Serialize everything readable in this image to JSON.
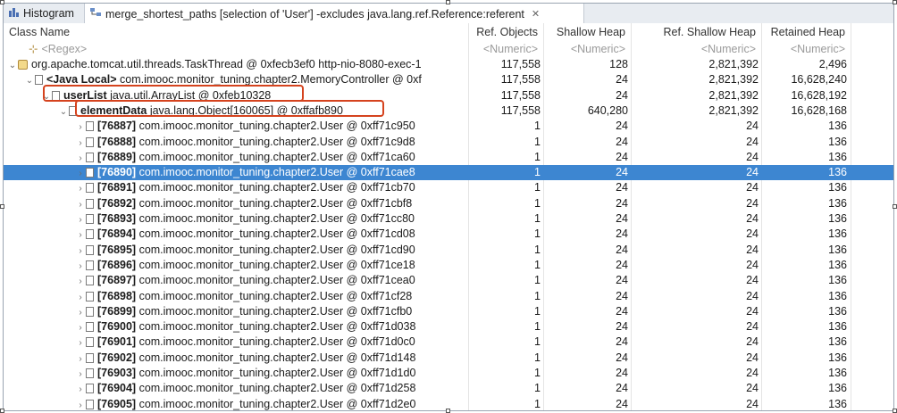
{
  "tabs": [
    {
      "label": "Histogram"
    },
    {
      "label": "merge_shortest_paths [selection of 'User'] -excludes java.lang.ref.Reference:referent"
    }
  ],
  "columns": [
    "Class Name",
    "Ref. Objects",
    "Shallow Heap",
    "Ref. Shallow Heap",
    "Retained Heap"
  ],
  "filters": [
    "<Regex>",
    "<Numeric>",
    "<Numeric>",
    "<Numeric>",
    "<Numeric>"
  ],
  "rows": [
    {
      "name": "org.apache.tomcat.util.threads.TaskThread @ 0xfecb3ef0  http-nio-8080-exec-1",
      "ref": "117,558",
      "shallow": "128",
      "ref_shallow": "2,821,392",
      "retained": "2,496"
    },
    {
      "name_bold": "<Java Local>",
      "name": "com.imooc.monitor_tuning.chapter2.MemoryController @ 0xf",
      "ref": "117,558",
      "shallow": "24",
      "ref_shallow": "2,821,392",
      "retained": "16,628,240"
    },
    {
      "name_bold": "userList",
      "name": "java.util.ArrayList @ 0xfeb10328",
      "ref": "117,558",
      "shallow": "24",
      "ref_shallow": "2,821,392",
      "retained": "16,628,192"
    },
    {
      "name_bold": "elementData",
      "name": "java.lang.Object[160065] @ 0xffafb890",
      "ref": "117,558",
      "shallow": "640,280",
      "ref_shallow": "2,821,392",
      "retained": "16,628,168"
    },
    {
      "name_bold": "[76887]",
      "name": "com.imooc.monitor_tuning.chapter2.User @ 0xff71c950",
      "ref": "1",
      "shallow": "24",
      "ref_shallow": "24",
      "retained": "136"
    },
    {
      "name_bold": "[76888]",
      "name": "com.imooc.monitor_tuning.chapter2.User @ 0xff71c9d8",
      "ref": "1",
      "shallow": "24",
      "ref_shallow": "24",
      "retained": "136"
    },
    {
      "name_bold": "[76889]",
      "name": "com.imooc.monitor_tuning.chapter2.User @ 0xff71ca60",
      "ref": "1",
      "shallow": "24",
      "ref_shallow": "24",
      "retained": "136"
    },
    {
      "name_bold": "[76890]",
      "name": "com.imooc.monitor_tuning.chapter2.User @ 0xff71cae8",
      "ref": "1",
      "shallow": "24",
      "ref_shallow": "24",
      "retained": "136",
      "selected": true
    },
    {
      "name_bold": "[76891]",
      "name": "com.imooc.monitor_tuning.chapter2.User @ 0xff71cb70",
      "ref": "1",
      "shallow": "24",
      "ref_shallow": "24",
      "retained": "136"
    },
    {
      "name_bold": "[76892]",
      "name": "com.imooc.monitor_tuning.chapter2.User @ 0xff71cbf8",
      "ref": "1",
      "shallow": "24",
      "ref_shallow": "24",
      "retained": "136"
    },
    {
      "name_bold": "[76893]",
      "name": "com.imooc.monitor_tuning.chapter2.User @ 0xff71cc80",
      "ref": "1",
      "shallow": "24",
      "ref_shallow": "24",
      "retained": "136"
    },
    {
      "name_bold": "[76894]",
      "name": "com.imooc.monitor_tuning.chapter2.User @ 0xff71cd08",
      "ref": "1",
      "shallow": "24",
      "ref_shallow": "24",
      "retained": "136"
    },
    {
      "name_bold": "[76895]",
      "name": "com.imooc.monitor_tuning.chapter2.User @ 0xff71cd90",
      "ref": "1",
      "shallow": "24",
      "ref_shallow": "24",
      "retained": "136"
    },
    {
      "name_bold": "[76896]",
      "name": "com.imooc.monitor_tuning.chapter2.User @ 0xff71ce18",
      "ref": "1",
      "shallow": "24",
      "ref_shallow": "24",
      "retained": "136"
    },
    {
      "name_bold": "[76897]",
      "name": "com.imooc.monitor_tuning.chapter2.User @ 0xff71cea0",
      "ref": "1",
      "shallow": "24",
      "ref_shallow": "24",
      "retained": "136"
    },
    {
      "name_bold": "[76898]",
      "name": "com.imooc.monitor_tuning.chapter2.User @ 0xff71cf28",
      "ref": "1",
      "shallow": "24",
      "ref_shallow": "24",
      "retained": "136"
    },
    {
      "name_bold": "[76899]",
      "name": "com.imooc.monitor_tuning.chapter2.User @ 0xff71cfb0",
      "ref": "1",
      "shallow": "24",
      "ref_shallow": "24",
      "retained": "136"
    },
    {
      "name_bold": "[76900]",
      "name": "com.imooc.monitor_tuning.chapter2.User @ 0xff71d038",
      "ref": "1",
      "shallow": "24",
      "ref_shallow": "24",
      "retained": "136"
    },
    {
      "name_bold": "[76901]",
      "name": "com.imooc.monitor_tuning.chapter2.User @ 0xff71d0c0",
      "ref": "1",
      "shallow": "24",
      "ref_shallow": "24",
      "retained": "136"
    },
    {
      "name_bold": "[76902]",
      "name": "com.imooc.monitor_tuning.chapter2.User @ 0xff71d148",
      "ref": "1",
      "shallow": "24",
      "ref_shallow": "24",
      "retained": "136"
    },
    {
      "name_bold": "[76903]",
      "name": "com.imooc.monitor_tuning.chapter2.User @ 0xff71d1d0",
      "ref": "1",
      "shallow": "24",
      "ref_shallow": "24",
      "retained": "136"
    },
    {
      "name_bold": "[76904]",
      "name": "com.imooc.monitor_tuning.chapter2.User @ 0xff71d258",
      "ref": "1",
      "shallow": "24",
      "ref_shallow": "24",
      "retained": "136"
    },
    {
      "name_bold": "[76905]",
      "name": "com.imooc.monitor_tuning.chapter2.User @ 0xff71d2e0",
      "ref": "1",
      "shallow": "24",
      "ref_shallow": "24",
      "retained": "136"
    }
  ],
  "colors": {
    "selection": "#3d86d1",
    "highlight": "#d5431e"
  }
}
